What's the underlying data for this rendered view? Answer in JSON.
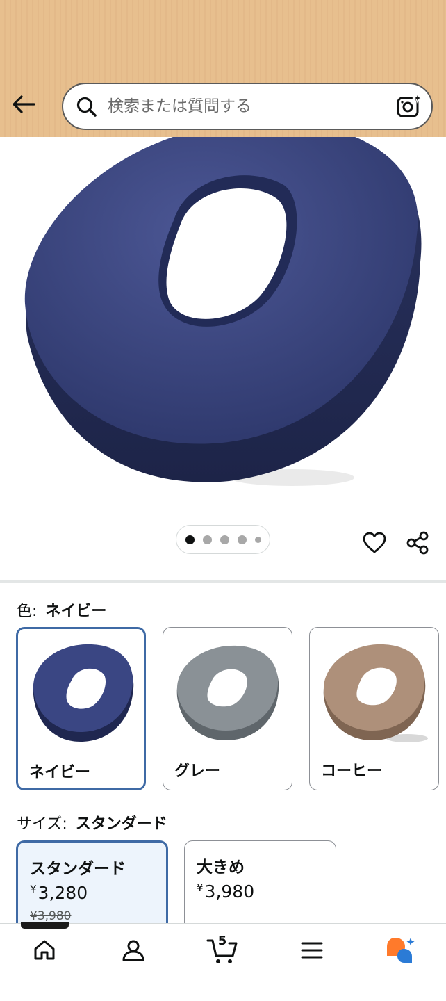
{
  "header": {
    "search_placeholder": "検索または質問する"
  },
  "carousel": {
    "total_dots": 5,
    "active_index": 0
  },
  "color": {
    "label": "色:",
    "selected": "ネイビー",
    "options": [
      {
        "name": "ネイビー",
        "hex": "#2f3a6e"
      },
      {
        "name": "グレー",
        "hex": "#7e8589"
      },
      {
        "name": "コーヒー",
        "hex": "#a88a72"
      }
    ]
  },
  "size": {
    "label": "サイズ:",
    "selected": "スタンダード",
    "options": [
      {
        "name": "スタンダード",
        "currency": "¥",
        "price": "3,280",
        "old_price": "¥3,980"
      },
      {
        "name": "大きめ",
        "currency": "¥",
        "price": "3,980"
      }
    ]
  },
  "bottom_nav": {
    "cart_count": "5",
    "items": [
      "home-icon",
      "account-icon",
      "cart-icon",
      "menu-icon",
      "rufus-icon"
    ]
  },
  "colors": {
    "header_bg": "#e7bf8e",
    "selected_border": "#3f6aa5",
    "selected_bg": "#edf4fc",
    "product": "#2f3a6e"
  }
}
